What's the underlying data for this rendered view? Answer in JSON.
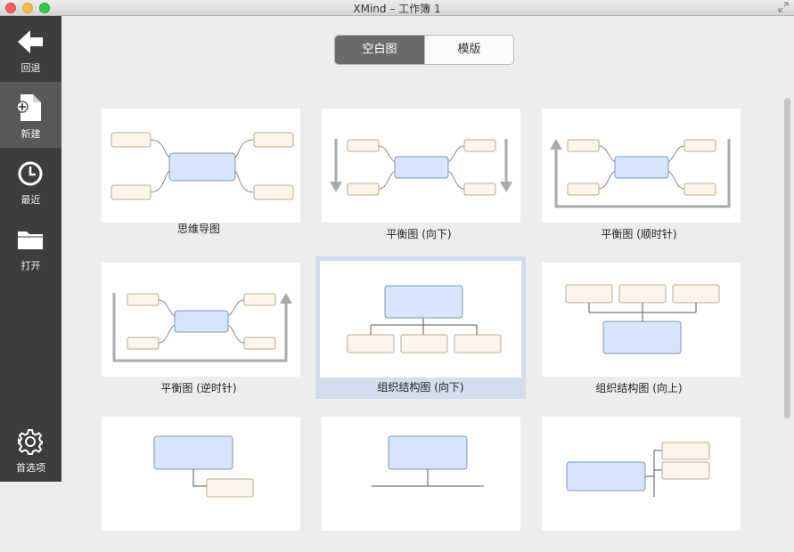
{
  "window": {
    "title": "XMind – 工作簿 1"
  },
  "sidebar": {
    "items": [
      {
        "label": "回退",
        "icon": "back-arrow-icon"
      },
      {
        "label": "新建",
        "icon": "new-document-icon"
      },
      {
        "label": "最近",
        "icon": "clock-icon"
      },
      {
        "label": "打开",
        "icon": "folder-icon"
      },
      {
        "label": "首选项",
        "icon": "gear-icon"
      }
    ],
    "active_index": 1
  },
  "segment": {
    "blank_label": "空白图",
    "template_label": "模版",
    "selected": "空白图"
  },
  "templates": [
    {
      "label": "思维导图"
    },
    {
      "label": "平衡图 (向下)"
    },
    {
      "label": "平衡图 (顺时针)"
    },
    {
      "label": "平衡图 (逆时针)"
    },
    {
      "label": "组织结构图 (向下)"
    },
    {
      "label": "组织结构图 (向上)"
    },
    {
      "label": ""
    },
    {
      "label": ""
    },
    {
      "label": ""
    }
  ],
  "selected_template": "组织结构图 (向下)",
  "colors": {
    "sidebar": "#3d3d3d",
    "central_topic": "#d6e5fb",
    "subtopic": "#fdf5ea",
    "selection": "#d2dded"
  }
}
